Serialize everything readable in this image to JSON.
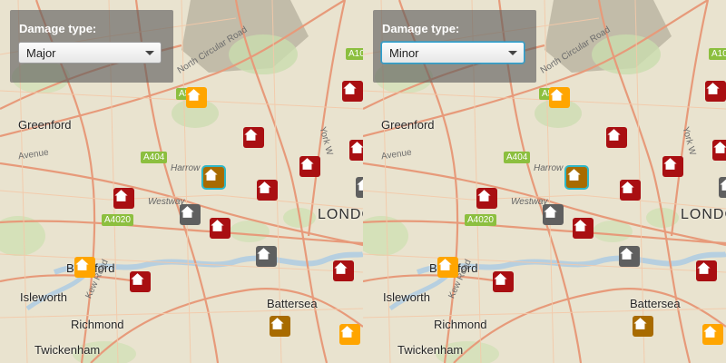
{
  "panels": {
    "left": {
      "filter_title": "Damage type:",
      "selected_value": "Major"
    },
    "right": {
      "filter_title": "Damage type:",
      "selected_value": "Minor"
    }
  },
  "map_labels": {
    "greenford": "Greenford",
    "london": "LONDO",
    "isleworth": "Isleworth",
    "richmond": "Richmond",
    "twickenham": "Twickenham",
    "brentford": "Brentford",
    "battersea": "Battersea",
    "harrow_road": "Harrow",
    "westway": "Westway",
    "north_circular": "North Circular Road",
    "avenue": "Avenue",
    "york_way": "York W",
    "kew_road": "Kew Road",
    "a404": "A404",
    "a4020": "A4020",
    "a5": "A5",
    "a10": "A10"
  },
  "colors": {
    "major": "#a90f12",
    "minor": "#ffa500",
    "affected": "#a86b00",
    "inaccessible": "#5f5f5f",
    "highlight": "#2fb7c7"
  },
  "icons": {
    "marker_glyph": "house-icon",
    "dropdown_arrow": "chevron-down-icon"
  },
  "markers": [
    {
      "type": "minor"
    },
    {
      "type": "major"
    },
    {
      "type": "major"
    },
    {
      "type": "major"
    },
    {
      "type": "affected"
    },
    {
      "type": "major"
    },
    {
      "type": "major"
    },
    {
      "type": "inaccessible"
    },
    {
      "type": "major"
    },
    {
      "type": "minor"
    },
    {
      "type": "major"
    },
    {
      "type": "inaccessible"
    },
    {
      "type": "major"
    },
    {
      "type": "major"
    },
    {
      "type": "inaccessible"
    },
    {
      "type": "affected"
    },
    {
      "type": "minor"
    }
  ]
}
